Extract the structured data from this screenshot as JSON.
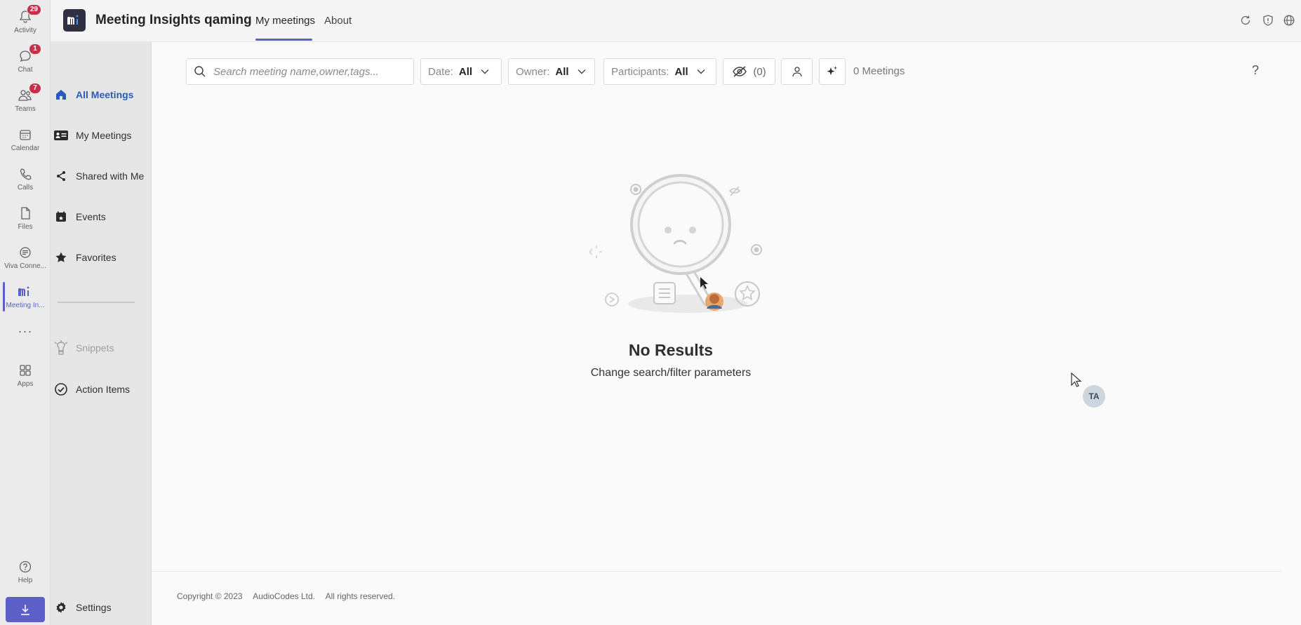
{
  "rail": {
    "items": [
      {
        "label": "Activity",
        "badge": "29"
      },
      {
        "label": "Chat",
        "badge": "1"
      },
      {
        "label": "Teams",
        "badge": "7"
      },
      {
        "label": "Calendar"
      },
      {
        "label": "Calls"
      },
      {
        "label": "Files"
      },
      {
        "label": "Viva Conne..."
      },
      {
        "label": "Meeting In..."
      },
      {
        "label": "Apps"
      },
      {
        "label": "Help"
      }
    ],
    "more": "···"
  },
  "header": {
    "title": "Meeting Insights qaming",
    "tabs": [
      {
        "label": "My meetings"
      },
      {
        "label": "About"
      }
    ]
  },
  "sidebar": {
    "items": [
      {
        "label": "All Meetings",
        "icon": "home-icon"
      },
      {
        "label": "My Meetings",
        "icon": "contact-card-icon"
      },
      {
        "label": "Shared with Me",
        "icon": "share-icon"
      },
      {
        "label": "Events",
        "icon": "calendar-icon"
      },
      {
        "label": "Favorites",
        "icon": "star-icon"
      },
      {
        "label": "Snippets",
        "icon": "lightbulb-icon"
      },
      {
        "label": "Action Items",
        "icon": "check-circle-icon"
      }
    ],
    "settings_label": "Settings"
  },
  "toolbar": {
    "search_placeholder": "Search meeting name,owner,tags...",
    "date_label": "Date:",
    "date_value": "All",
    "owner_label": "Owner:",
    "owner_value": "All",
    "participants_label": "Participants:",
    "participants_value": "All",
    "hidden_count": "(0)",
    "meetings_count": "0 Meetings",
    "help": "?"
  },
  "empty_state": {
    "title": "No Results",
    "subtitle": "Change search/filter parameters"
  },
  "avatar_initials": "TA",
  "footer": {
    "copyright": "Copyright © 2023",
    "company": "AudioCodes Ltd.",
    "rights": "All rights reserved."
  },
  "colors": {
    "accent": "#5b5fc7",
    "badge": "#c4314b",
    "active_nav": "#2b5bb8"
  }
}
